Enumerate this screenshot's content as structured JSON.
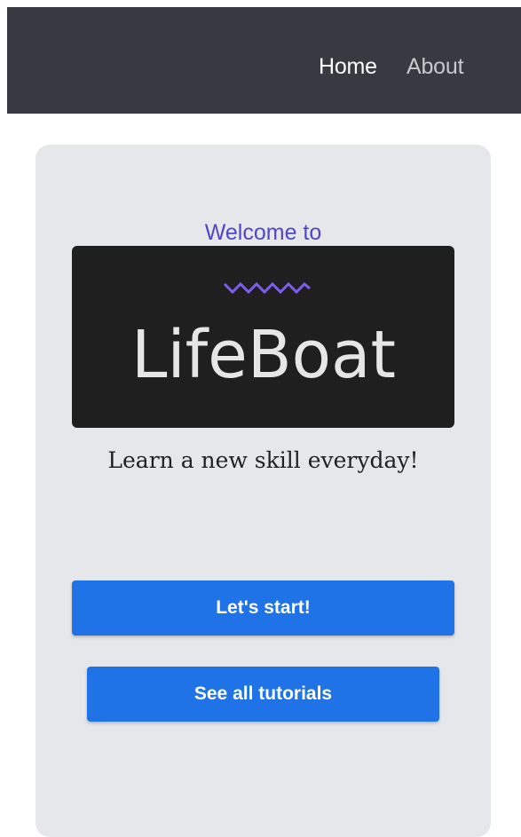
{
  "nav": {
    "home_label": "Home",
    "about_label": "About"
  },
  "hero": {
    "welcome_text": "Welcome to",
    "logo_text": "LifeBoat",
    "tagline": "Learn a new skill everyday!"
  },
  "actions": {
    "start_label": "Let's start!",
    "tutorials_label": "See all tutorials"
  },
  "colors": {
    "navbar_bg": "#373a40",
    "card_bg": "#e5e7eb",
    "accent_purple": "#5046c8",
    "button_blue": "#1f73e6",
    "logo_bg": "#1f1f1f",
    "logo_wave": "#7b5ff0"
  }
}
